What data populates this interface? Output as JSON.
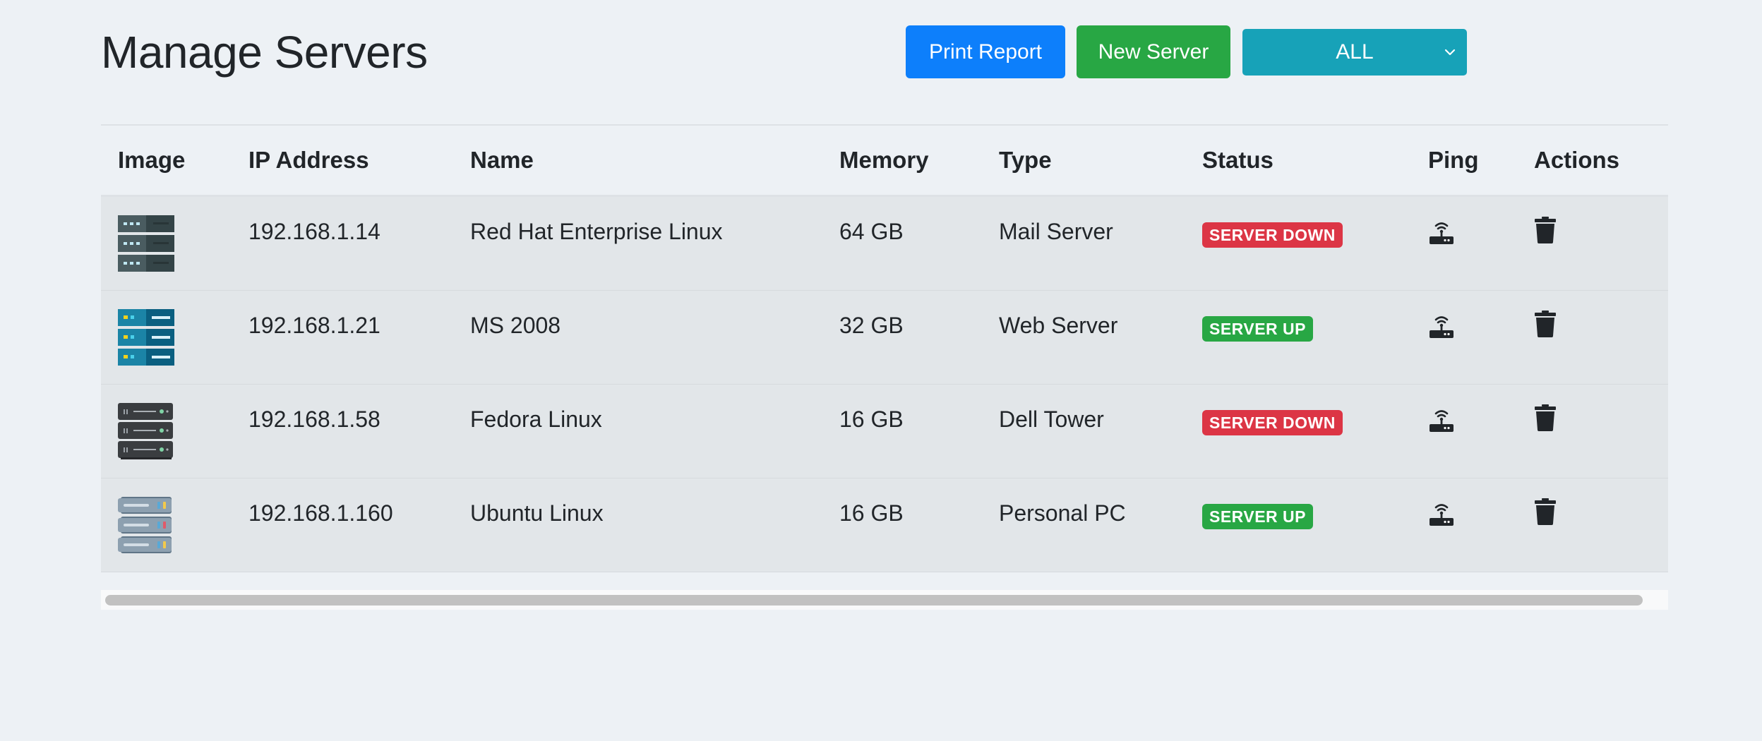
{
  "page": {
    "title": "Manage Servers"
  },
  "toolbar": {
    "print_label": "Print Report",
    "new_label": "New Server",
    "filter_value": "ALL"
  },
  "table": {
    "columns": [
      "Image",
      "IP Address",
      "Name",
      "Memory",
      "Type",
      "Status",
      "Ping",
      "Actions"
    ],
    "rows": [
      {
        "image": "server-rack-slate-icon",
        "ip": "192.168.1.14",
        "name": "Red Hat Enterprise Linux",
        "memory": "64 GB",
        "type": "Mail Server",
        "status": "SERVER DOWN",
        "status_color": "#dc3545"
      },
      {
        "image": "server-rack-blue-icon",
        "ip": "192.168.1.21",
        "name": "MS 2008",
        "memory": "32 GB",
        "type": "Web Server",
        "status": "SERVER UP",
        "status_color": "#28a744"
      },
      {
        "image": "server-rack-dark-icon",
        "ip": "192.168.1.58",
        "name": "Fedora Linux",
        "memory": "16 GB",
        "type": "Dell Tower",
        "status": "SERVER DOWN",
        "status_color": "#dc3545"
      },
      {
        "image": "server-rack-gray-icon",
        "ip": "192.168.1.160",
        "name": "Ubuntu Linux",
        "memory": "16 GB",
        "type": "Personal PC",
        "status": "SERVER UP",
        "status_color": "#28a744"
      }
    ]
  },
  "icons": {
    "ping": "router-icon",
    "delete": "trash-icon",
    "select_arrow": "chevron-down-icon"
  },
  "colors": {
    "primary": "#0d7ffb",
    "success": "#28a744",
    "info": "#17a2b8",
    "danger": "#dc3545",
    "background": "#edf1f5",
    "row_background": "#e2e6e9"
  }
}
